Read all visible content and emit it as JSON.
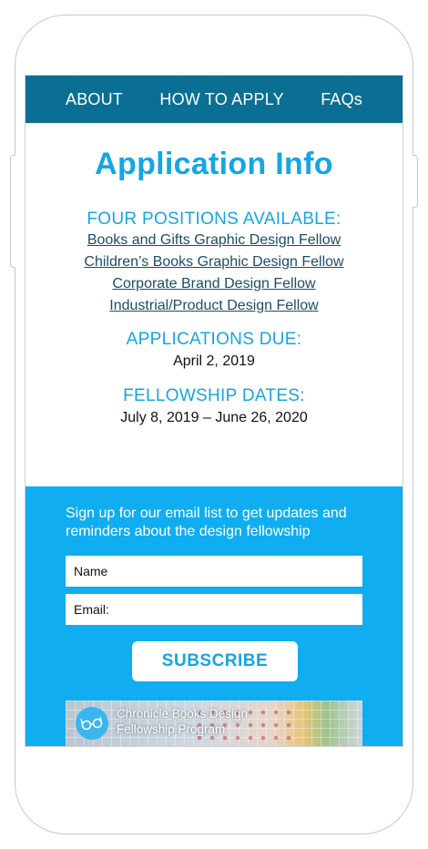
{
  "nav": {
    "items": [
      "ABOUT",
      "HOW TO APPLY",
      "FAQs"
    ]
  },
  "page_title": "Application Info",
  "positions": {
    "heading": "FOUR POSITIONS AVAILABLE:",
    "links": [
      "Books and Gifts Graphic Design Fellow",
      "Children’s Books Graphic Design Fellow",
      "Corporate Brand Design Fellow",
      "Industrial/Product Design Fellow"
    ]
  },
  "applications": {
    "heading": "APPLICATIONS DUE:",
    "date": "April 2, 2019"
  },
  "fellowship": {
    "heading": "FELLOWSHIP DATES:",
    "dates": "July 8, 2019 – June 26, 2020"
  },
  "signup": {
    "text": "Sign up for our email list to get updates and reminders about the design fellowship",
    "name_placeholder": "Name",
    "email_placeholder": "Email:",
    "button": "SUBSCRIBE"
  },
  "video": {
    "title_line1": "Chronicle Books Design",
    "title_line2": "Fellowship Program",
    "channel_icon": "glasses-icon"
  },
  "colors": {
    "nav_bg": "#0a6f93",
    "accent": "#14a6e3",
    "signup_bg": "#10adf0",
    "link": "#1c4c68"
  }
}
